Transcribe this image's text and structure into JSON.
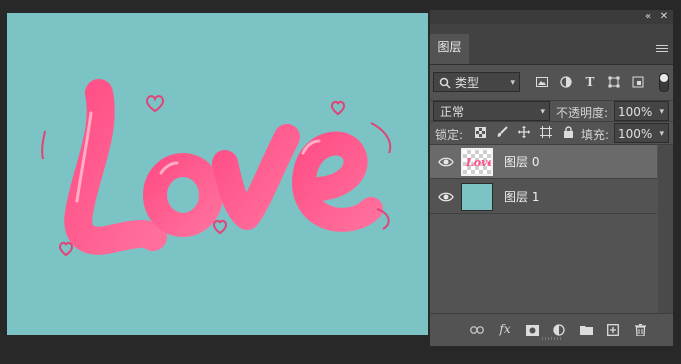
{
  "canvas": {
    "background": "#7cc3c5",
    "artwork_text": "Love",
    "artwork_color": "#ff5a8a"
  },
  "panel": {
    "collapse_icon": "double-chevron-left-icon",
    "close_icon": "close-icon",
    "tab_label": "图层",
    "menu_icon": "hamburger-menu-icon",
    "filter": {
      "kind_label": "类型",
      "icons": [
        "image-filter-icon",
        "adjustment-filter-icon",
        "type-filter-icon",
        "shape-filter-icon",
        "smart-object-filter-icon"
      ]
    },
    "blend_mode": "正常",
    "opacity_label": "不透明度:",
    "opacity_value": "100%",
    "lock_label": "锁定:",
    "lock_icons": [
      "lock-transparency-icon",
      "lock-paint-icon",
      "lock-position-icon",
      "lock-artboard-icon",
      "lock-all-icon"
    ],
    "fill_label": "填充:",
    "fill_value": "100%",
    "layers": [
      {
        "name": "图层 0",
        "visible": true,
        "selected": true
      },
      {
        "name": "图层 1",
        "visible": true,
        "selected": false
      }
    ],
    "bottom_icons": [
      "link-icon",
      "fx-icon",
      "mask-icon",
      "adjustment-layer-icon",
      "folder-icon",
      "new-layer-icon",
      "trash-icon"
    ],
    "fx_label": "fx"
  }
}
